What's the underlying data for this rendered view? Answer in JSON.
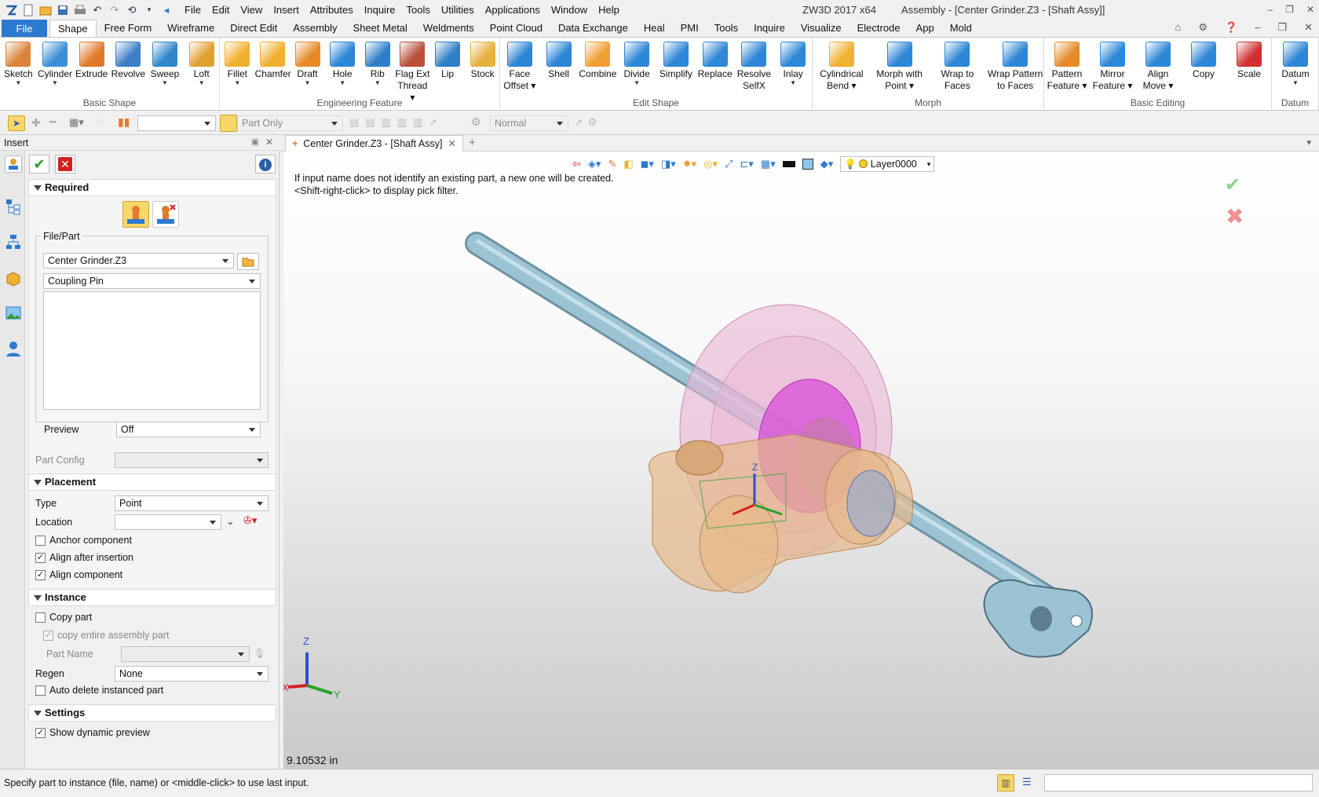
{
  "app": {
    "quick_access_icons": [
      "app-logo-icon",
      "new-icon",
      "open-icon",
      "save-icon",
      "print-icon",
      "undo-icon",
      "redo-icon",
      "rotate-icon",
      "dropdown-icon",
      "back-arrow-icon"
    ],
    "menus": [
      "File",
      "Edit",
      "View",
      "Insert",
      "Attributes",
      "Inquire",
      "Tools",
      "Utilities",
      "Applications",
      "Window",
      "Help"
    ],
    "title_product": "ZW3D 2017  x64",
    "title_doc": "Assembly - [Center Grinder.Z3 - [Shaft Assy]]"
  },
  "ribbon_tabs": {
    "file": "File",
    "tabs": [
      "Shape",
      "Free Form",
      "Wireframe",
      "Direct Edit",
      "Assembly",
      "Sheet Metal",
      "Weldments",
      "Point Cloud",
      "Data Exchange",
      "Heal",
      "PMI",
      "Tools",
      "Inquire",
      "Visualize",
      "Electrode",
      "App",
      "Mold"
    ],
    "active": "Shape"
  },
  "ribbon": {
    "groups": [
      {
        "label": "Basic Shape",
        "buttons": [
          {
            "l1": "Sketch",
            "l2": "",
            "dd": true,
            "color": "#d9843a"
          },
          {
            "l1": "Cylinder",
            "l2": "",
            "dd": true,
            "color": "#3b8fd6"
          },
          {
            "l1": "Extrude",
            "l2": "",
            "dd": false,
            "color": "#e07a2a"
          },
          {
            "l1": "Revolve",
            "l2": "",
            "dd": false,
            "color": "#3b7fc4"
          },
          {
            "l1": "Sweep",
            "l2": "",
            "dd": true,
            "color": "#2f86c9"
          },
          {
            "l1": "Loft",
            "l2": "",
            "dd": true,
            "color": "#e0a030"
          }
        ]
      },
      {
        "label": "Engineering Feature",
        "buttons": [
          {
            "l1": "Fillet",
            "l2": "",
            "dd": true,
            "color": "#f0b030"
          },
          {
            "l1": "Chamfer",
            "l2": "",
            "dd": false,
            "color": "#f0b030"
          },
          {
            "l1": "Draft",
            "l2": "",
            "dd": true,
            "color": "#e68a2a"
          },
          {
            "l1": "Hole",
            "l2": "",
            "dd": true,
            "color": "#2d86d6"
          },
          {
            "l1": "Rib",
            "l2": "",
            "dd": true,
            "color": "#2d7fc6"
          },
          {
            "l1": "Flag Ext",
            "l2": "Thread",
            "dd": true,
            "color": "#b8503a"
          },
          {
            "l1": "Lip",
            "l2": "",
            "dd": false,
            "color": "#2d7fc6"
          },
          {
            "l1": "Stock",
            "l2": "",
            "dd": false,
            "color": "#e8b040"
          }
        ]
      },
      {
        "label": "Edit Shape",
        "buttons": [
          {
            "l1": "Face",
            "l2": "Offset",
            "dd": true,
            "color": "#2d86d6"
          },
          {
            "l1": "Shell",
            "l2": "",
            "dd": false,
            "color": "#2d86d6"
          },
          {
            "l1": "Combine",
            "l2": "",
            "dd": false,
            "color": "#f0a030"
          },
          {
            "l1": "Divide",
            "l2": "",
            "dd": true,
            "color": "#2d86d6"
          },
          {
            "l1": "Simplify",
            "l2": "",
            "dd": false,
            "color": "#2d86d6"
          },
          {
            "l1": "Replace",
            "l2": "",
            "dd": false,
            "color": "#2d86d6"
          },
          {
            "l1": "Resolve",
            "l2": "SelfX",
            "dd": false,
            "color": "#2d86d6"
          },
          {
            "l1": "Inlay",
            "l2": "",
            "dd": true,
            "color": "#2d86d6"
          }
        ]
      },
      {
        "label": "Morph",
        "buttons": [
          {
            "l1": "Cylindrical",
            "l2": "Bend",
            "dd": true,
            "color": "#f0b030"
          },
          {
            "l1": "Morph with",
            "l2": "Point",
            "dd": true,
            "color": "#2d86d6"
          },
          {
            "l1": "Wrap to",
            "l2": "Faces",
            "dd": false,
            "color": "#2d86d6"
          },
          {
            "l1": "Wrap Pattern",
            "l2": "to Faces",
            "dd": false,
            "color": "#2d86d6"
          }
        ]
      },
      {
        "label": "Basic Editing",
        "buttons": [
          {
            "l1": "Pattern",
            "l2": "Feature",
            "dd": true,
            "color": "#e68a2a"
          },
          {
            "l1": "Mirror",
            "l2": "Feature",
            "dd": true,
            "color": "#2d86d6"
          },
          {
            "l1": "Align",
            "l2": "Move",
            "dd": true,
            "color": "#2d86d6"
          },
          {
            "l1": "Copy",
            "l2": "",
            "dd": false,
            "color": "#2d86d6"
          },
          {
            "l1": "Scale",
            "l2": "",
            "dd": false,
            "color": "#d03030"
          }
        ]
      },
      {
        "label": "Datum",
        "buttons": [
          {
            "l1": "Datum",
            "l2": "",
            "dd": true,
            "color": "#2d86d6"
          }
        ]
      }
    ]
  },
  "toolbar2": {
    "filter_value": "Part Only",
    "style_value": "Normal"
  },
  "panel": {
    "title": "Insert",
    "required": "Required",
    "file_part_legend": "File/Part",
    "file_value": "Center Grinder.Z3",
    "part_name_value": "Coupling Pin",
    "preview_label": "Preview",
    "preview_value": "Off",
    "part_config_label": "Part Config",
    "placement": "Placement",
    "type_label": "Type",
    "type_value": "Point",
    "location_label": "Location",
    "anchor_label": "Anchor component",
    "align_after_label": "Align after insertion",
    "align_component_label": "Align component",
    "instance": "Instance",
    "copy_part_label": "Copy part",
    "copy_entire_label": "copy entire assembly part",
    "part_name_label": "Part  Name",
    "regen_label": "Regen",
    "regen_value": "None",
    "auto_delete_label": "Auto delete instanced part",
    "settings": "Settings",
    "show_preview_label": "Show dynamic preview"
  },
  "checks": {
    "anchor": false,
    "align_after": true,
    "align_component": true,
    "copy_part": false,
    "copy_entire": true,
    "auto_delete": false,
    "show_preview": true
  },
  "document": {
    "tab_label": "Center Grinder.Z3 - [Shaft Assy]",
    "layer": "Layer0000",
    "hint1": "If input name does not identify an existing part, a new one will be created.",
    "hint2": "<Shift-right-click> to display pick filter.",
    "measure": "9.10532 in",
    "axis_x": "X",
    "axis_y": "Y",
    "axis_z": "Z"
  },
  "status": {
    "prompt": "Specify part to instance (file, name) or <middle-click> to use last input."
  },
  "colors": {
    "accent": "#2b79d0",
    "shaft": "#9cc3d4",
    "housing": "#e5b98a",
    "wheel": "#e9b6d6",
    "magenta": "#d84ed8",
    "ok_green": "#2a9a2a",
    "cancel_red": "#d32020"
  }
}
